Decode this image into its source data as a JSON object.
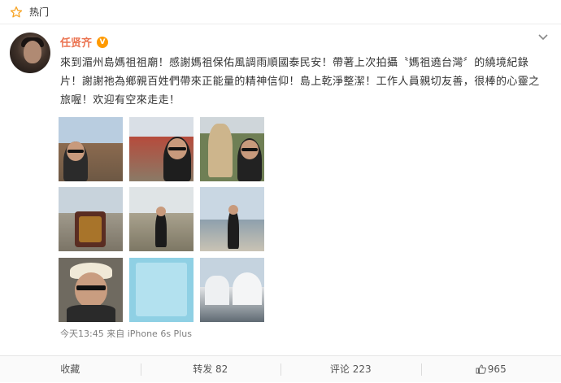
{
  "topbar": {
    "label": "热门",
    "icon": "star-outline-icon"
  },
  "post": {
    "author_name": "任贤齐",
    "verified_badge": "V",
    "text": "來到湄州島媽祖祖廟！感謝媽祖保佑風調雨順國泰民安！帶著上次拍攝〝媽祖遶台灣〞的繞境紀錄片！謝謝祂為鄉親百姓們帶來正能量的精神信仰！島上乾淨整潔！工作人員親切友善，很棒的心靈之旅喔！欢迎有空來走走！",
    "meta": "今天13:45 来自 iPhone 6s Plus",
    "image_count": 9
  },
  "actions": {
    "favorite": "收藏",
    "repost": "转发 82",
    "comment": "评论 223",
    "like": "965"
  },
  "colors": {
    "author": "#eb7350",
    "badge": "#ff9a00",
    "meta": "#808080"
  }
}
